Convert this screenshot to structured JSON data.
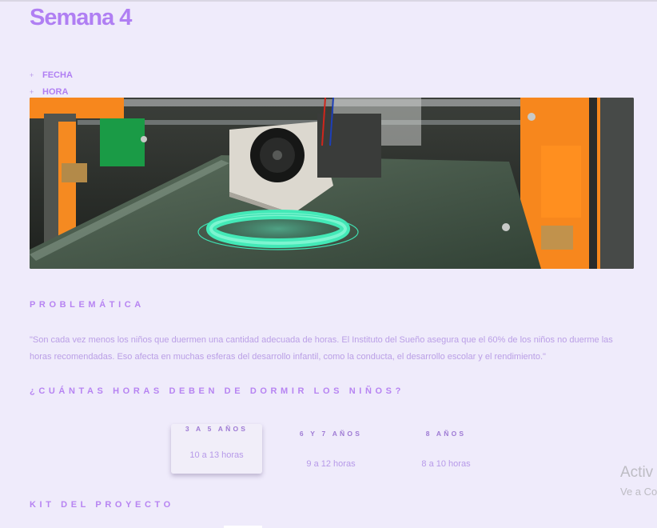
{
  "page": {
    "title": "Semana 4",
    "meta": [
      "FECHA",
      "HORA"
    ]
  },
  "hero": {
    "image_icon": "3d-printer-image"
  },
  "problematica": {
    "heading": "PROBLEMÁTICA",
    "text": "\"Son cada vez menos los niños que duermen una cantidad adecuada de horas. El Instituto del Sueño asegura que el 60% de los niños no duerme las horas recomendadas. Eso afecta en muchas esferas del desarrollo infantil, como la conducta, el desarrollo escolar y el rendimiento.\""
  },
  "horas": {
    "heading": "¿CUÁNTAS HORAS DEBEN DE DORMIR LOS NIÑOS?",
    "items": [
      {
        "label": "3 A 5 AÑOS",
        "value": "10 a 13 horas",
        "active": true
      },
      {
        "label": "6 Y 7 AÑOS",
        "value": "9 a 12 horas",
        "active": false
      },
      {
        "label": "8 AÑOS",
        "value": "8 a 10 horas",
        "active": false
      }
    ]
  },
  "kit": {
    "heading": "KIT DEL PROYECTO"
  },
  "watermark": {
    "line1": "Activ",
    "line2": "Ve a Co"
  },
  "colors": {
    "background": "#efebfb",
    "accent": "#b07ff3",
    "body_text": "#ba9fe6"
  }
}
